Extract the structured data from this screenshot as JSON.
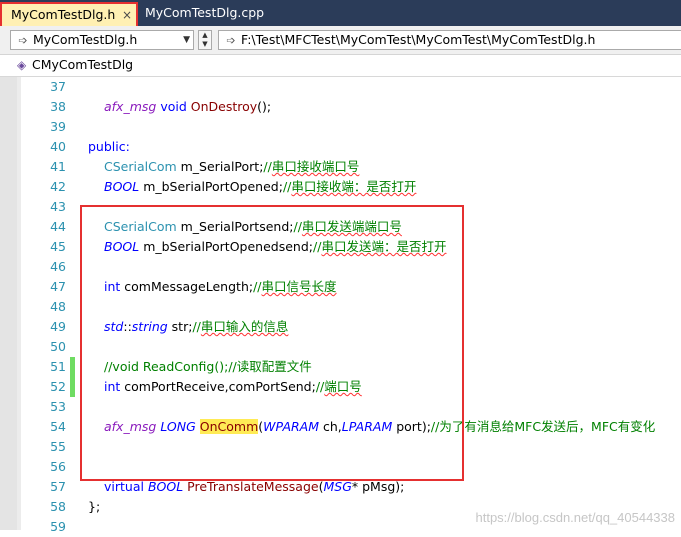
{
  "tabs": [
    {
      "label": "MyComTestDlg.h",
      "close": "×"
    },
    {
      "label": "MyComTestDlg.cpp"
    }
  ],
  "nav": {
    "file_combo": "MyComTestDlg.h",
    "path_combo": "F:\\Test\\MFCTest\\MyComTest\\MyComTest\\MyComTestDlg.h"
  },
  "classbar": {
    "class_name": "CMyComTestDlg"
  },
  "lines": [
    {
      "n": "37",
      "tokens": []
    },
    {
      "n": "38",
      "tokens": [
        {
          "t": "afx_msg",
          "c": "mac"
        },
        {
          "t": " void ",
          "c": "kw"
        },
        {
          "t": "OnDestroy",
          "c": "fn"
        },
        {
          "t": "();",
          "c": "id"
        }
      ],
      "indent": 1
    },
    {
      "n": "39",
      "tokens": []
    },
    {
      "n": "40",
      "tokens": [
        {
          "t": "public:",
          "c": "kw"
        }
      ],
      "indent": 0
    },
    {
      "n": "41",
      "tokens": [
        {
          "t": "CSerialCom",
          "c": "cls"
        },
        {
          "t": " m_SerialPort;",
          "c": "id"
        },
        {
          "t": "//",
          "c": "cm"
        },
        {
          "t": "串口接收端口号",
          "c": "cm sq"
        }
      ],
      "indent": 1
    },
    {
      "n": "42",
      "tokens": [
        {
          "t": "BOOL",
          "c": "ty"
        },
        {
          "t": " m_bSerialPortOpened;",
          "c": "id"
        },
        {
          "t": "//",
          "c": "cm"
        },
        {
          "t": "串口接收端：是否打开",
          "c": "cm sq"
        }
      ],
      "indent": 1
    },
    {
      "n": "43",
      "tokens": []
    },
    {
      "n": "44",
      "tokens": [
        {
          "t": "CSerialCom",
          "c": "cls"
        },
        {
          "t": " m_SerialPortsend;",
          "c": "id"
        },
        {
          "t": "//",
          "c": "cm"
        },
        {
          "t": "串口发送端端口号",
          "c": "cm sq"
        }
      ],
      "indent": 1
    },
    {
      "n": "45",
      "tokens": [
        {
          "t": "BOOL",
          "c": "ty"
        },
        {
          "t": " m_bSerialPortOpenedsend;",
          "c": "id"
        },
        {
          "t": "//",
          "c": "cm"
        },
        {
          "t": "串口发送端：是否打开",
          "c": "cm sq"
        }
      ],
      "indent": 1
    },
    {
      "n": "46",
      "tokens": []
    },
    {
      "n": "47",
      "tokens": [
        {
          "t": "int",
          "c": "kw"
        },
        {
          "t": " comMessageLength;",
          "c": "id"
        },
        {
          "t": "//",
          "c": "cm"
        },
        {
          "t": "串口信号长度",
          "c": "cm sq"
        }
      ],
      "indent": 1
    },
    {
      "n": "48",
      "tokens": []
    },
    {
      "n": "49",
      "tokens": [
        {
          "t": "std",
          "c": "ty"
        },
        {
          "t": "::",
          "c": "id"
        },
        {
          "t": "string",
          "c": "ty"
        },
        {
          "t": " str;",
          "c": "id"
        },
        {
          "t": "//",
          "c": "cm"
        },
        {
          "t": "串口输入的信息",
          "c": "cm sq"
        }
      ],
      "indent": 1
    },
    {
      "n": "50",
      "tokens": []
    },
    {
      "n": "51",
      "tokens": [
        {
          "t": "//void ReadConfig();//读取配置文件",
          "c": "cm"
        }
      ],
      "indent": 1,
      "changed": true
    },
    {
      "n": "52",
      "tokens": [
        {
          "t": "int",
          "c": "kw"
        },
        {
          "t": " comPortReceive,comPortSend;",
          "c": "id"
        },
        {
          "t": "//",
          "c": "cm"
        },
        {
          "t": "端口号",
          "c": "cm sq"
        }
      ],
      "indent": 1,
      "changed": true
    },
    {
      "n": "53",
      "tokens": []
    },
    {
      "n": "54",
      "tokens": [
        {
          "t": "afx_msg",
          "c": "mac"
        },
        {
          "t": " ",
          "c": "id"
        },
        {
          "t": "LONG",
          "c": "ty"
        },
        {
          "t": " ",
          "c": "id"
        },
        {
          "t": "OnComm",
          "c": "fn-hl"
        },
        {
          "t": "(",
          "c": "id"
        },
        {
          "t": "WPARAM",
          "c": "ty"
        },
        {
          "t": " ch,",
          "c": "id"
        },
        {
          "t": "LPARAM",
          "c": "ty"
        },
        {
          "t": " port);",
          "c": "id"
        },
        {
          "t": "//为了有消息给MFC发送后，MFC有变化",
          "c": "cm"
        }
      ],
      "indent": 1
    },
    {
      "n": "55",
      "tokens": []
    },
    {
      "n": "56",
      "tokens": []
    },
    {
      "n": "57",
      "tokens": [
        {
          "t": "virtual",
          "c": "kw"
        },
        {
          "t": " ",
          "c": "id"
        },
        {
          "t": "BOOL",
          "c": "ty"
        },
        {
          "t": " ",
          "c": "id"
        },
        {
          "t": "PreTranslateMessage",
          "c": "fn"
        },
        {
          "t": "(",
          "c": "id"
        },
        {
          "t": "MSG",
          "c": "ty"
        },
        {
          "t": "* pMsg);",
          "c": "id"
        }
      ],
      "indent": 1
    },
    {
      "n": "58",
      "tokens": [
        {
          "t": "};",
          "c": "id"
        }
      ],
      "indent": 0
    },
    {
      "n": "59",
      "tokens": []
    }
  ],
  "watermark": "https://blog.csdn.net/qq_40544338",
  "colors": {
    "tab_bar_bg": "#2b3c59",
    "active_tab_bg": "#fff0b3",
    "highlight_border": "#e53030",
    "line_number": "#2b91af",
    "keyword": "#0000ff",
    "comment": "#008000",
    "change_marker": "#6fdc62"
  }
}
